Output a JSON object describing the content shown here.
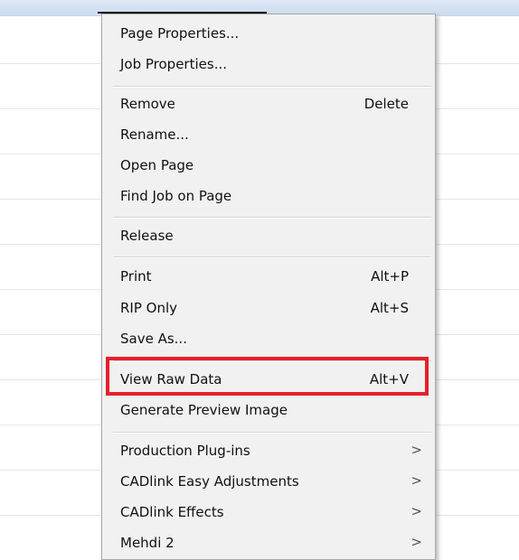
{
  "menu": {
    "items": [
      {
        "label": "Page Properties...",
        "shortcut": "",
        "submenu": false
      },
      {
        "label": "Job Properties...",
        "shortcut": "",
        "submenu": false
      },
      {
        "label": "Remove",
        "shortcut": "Delete",
        "submenu": false
      },
      {
        "label": "Rename...",
        "shortcut": "",
        "submenu": false
      },
      {
        "label": "Open Page",
        "shortcut": "",
        "submenu": false
      },
      {
        "label": "Find Job on Page",
        "shortcut": "",
        "submenu": false
      },
      {
        "label": "Release",
        "shortcut": "",
        "submenu": false
      },
      {
        "label": "Print",
        "shortcut": "Alt+P",
        "submenu": false
      },
      {
        "label": "RIP Only",
        "shortcut": "Alt+S",
        "submenu": false
      },
      {
        "label": "Save As...",
        "shortcut": "",
        "submenu": false
      },
      {
        "label": "View Raw Data",
        "shortcut": "Alt+V",
        "submenu": false,
        "highlighted": true
      },
      {
        "label": "Generate Preview Image",
        "shortcut": "",
        "submenu": false
      },
      {
        "label": "Production Plug-ins",
        "shortcut": "",
        "submenu": true,
        "arrow": ">"
      },
      {
        "label": "CADlink Easy Adjustments",
        "shortcut": "",
        "submenu": true,
        "arrow": ">"
      },
      {
        "label": "CADlink Effects",
        "shortcut": "",
        "submenu": true,
        "arrow": ">"
      },
      {
        "label": "Mehdi 2",
        "shortcut": "",
        "submenu": true,
        "arrow": ">"
      }
    ]
  },
  "colors": {
    "menu_background": "#f1f1f1",
    "highlight_border": "#e4212b",
    "text": "#111111"
  }
}
